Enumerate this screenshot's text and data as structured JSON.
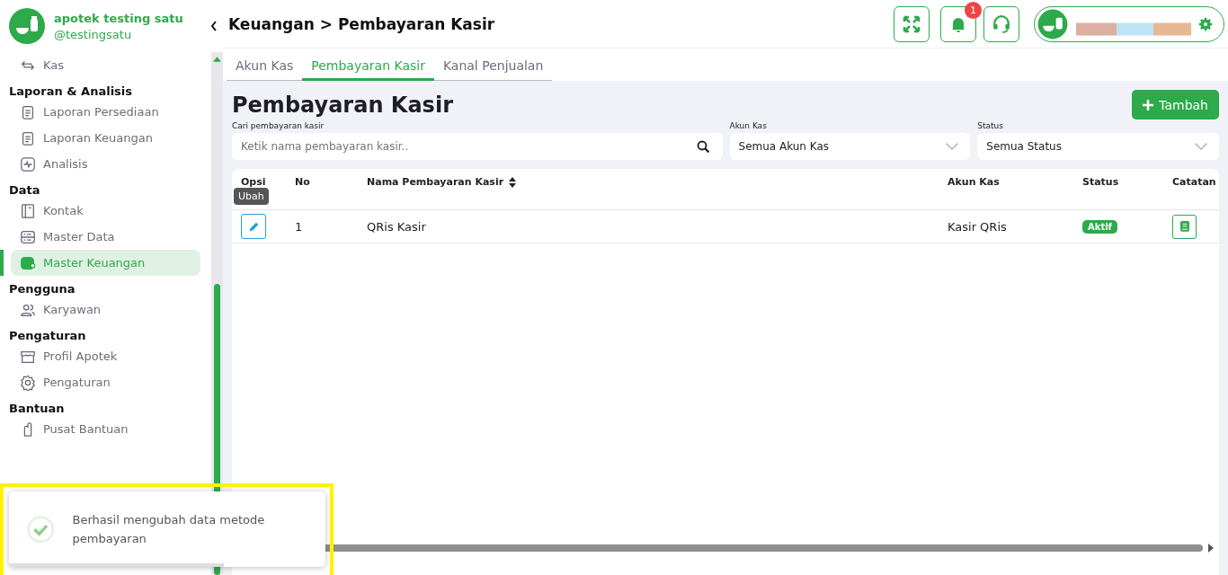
{
  "brand": {
    "name": "apotek testing satu",
    "handle": "@testingsatu"
  },
  "sidebar": {
    "groups": [
      {
        "items": [
          {
            "label": "Kas",
            "selected": false
          }
        ]
      },
      {
        "title": "Laporan & Analisis",
        "items": [
          {
            "label": "Laporan Persediaan",
            "selected": false
          },
          {
            "label": "Laporan Keuangan",
            "selected": false
          },
          {
            "label": "Analisis",
            "selected": false
          }
        ]
      },
      {
        "title": "Data",
        "items": [
          {
            "label": "Kontak",
            "selected": false
          },
          {
            "label": "Master Data",
            "selected": false
          },
          {
            "label": "Master Keuangan",
            "selected": true
          }
        ]
      },
      {
        "title": "Pengguna",
        "items": [
          {
            "label": "Karyawan",
            "selected": false
          }
        ]
      },
      {
        "title": "Pengaturan",
        "items": [
          {
            "label": "Profil Apotek",
            "selected": false
          },
          {
            "label": "Pengaturan",
            "selected": false
          }
        ]
      },
      {
        "title": "Bantuan",
        "items": [
          {
            "label": "Pusat Bantuan",
            "selected": false
          }
        ]
      }
    ]
  },
  "breadcrumb": "Keuangan > Pembayaran Kasir",
  "notification_count": "1",
  "tabs": [
    {
      "label": "Akun Kas",
      "selected": false
    },
    {
      "label": "Pembayaran Kasir",
      "selected": true
    },
    {
      "label": "Kanal Penjualan",
      "selected": false
    }
  ],
  "page_title": "Pembayaran Kasir",
  "add_button": "Tambah",
  "filters": {
    "search": {
      "label": "Cari pembayaran kasir",
      "placeholder": "Ketik nama pembayaran kasir.."
    },
    "account": {
      "label": "Akun Kas",
      "value": "Semua Akun Kas"
    },
    "status": {
      "label": "Status",
      "value": "Semua Status"
    }
  },
  "table": {
    "columns": [
      "Opsi",
      "No",
      "Nama Pembayaran Kasir",
      "Akun Kas",
      "Status",
      "Catatan"
    ],
    "rows": [
      {
        "no": "1",
        "name": "QRis Kasir",
        "account_value": "Kasir QRis",
        "status": "Aktif",
        "active": true
      }
    ]
  },
  "tooltip": "Ubah",
  "toast": {
    "message": "Berhasil mengubah data metode pembayaran"
  }
}
